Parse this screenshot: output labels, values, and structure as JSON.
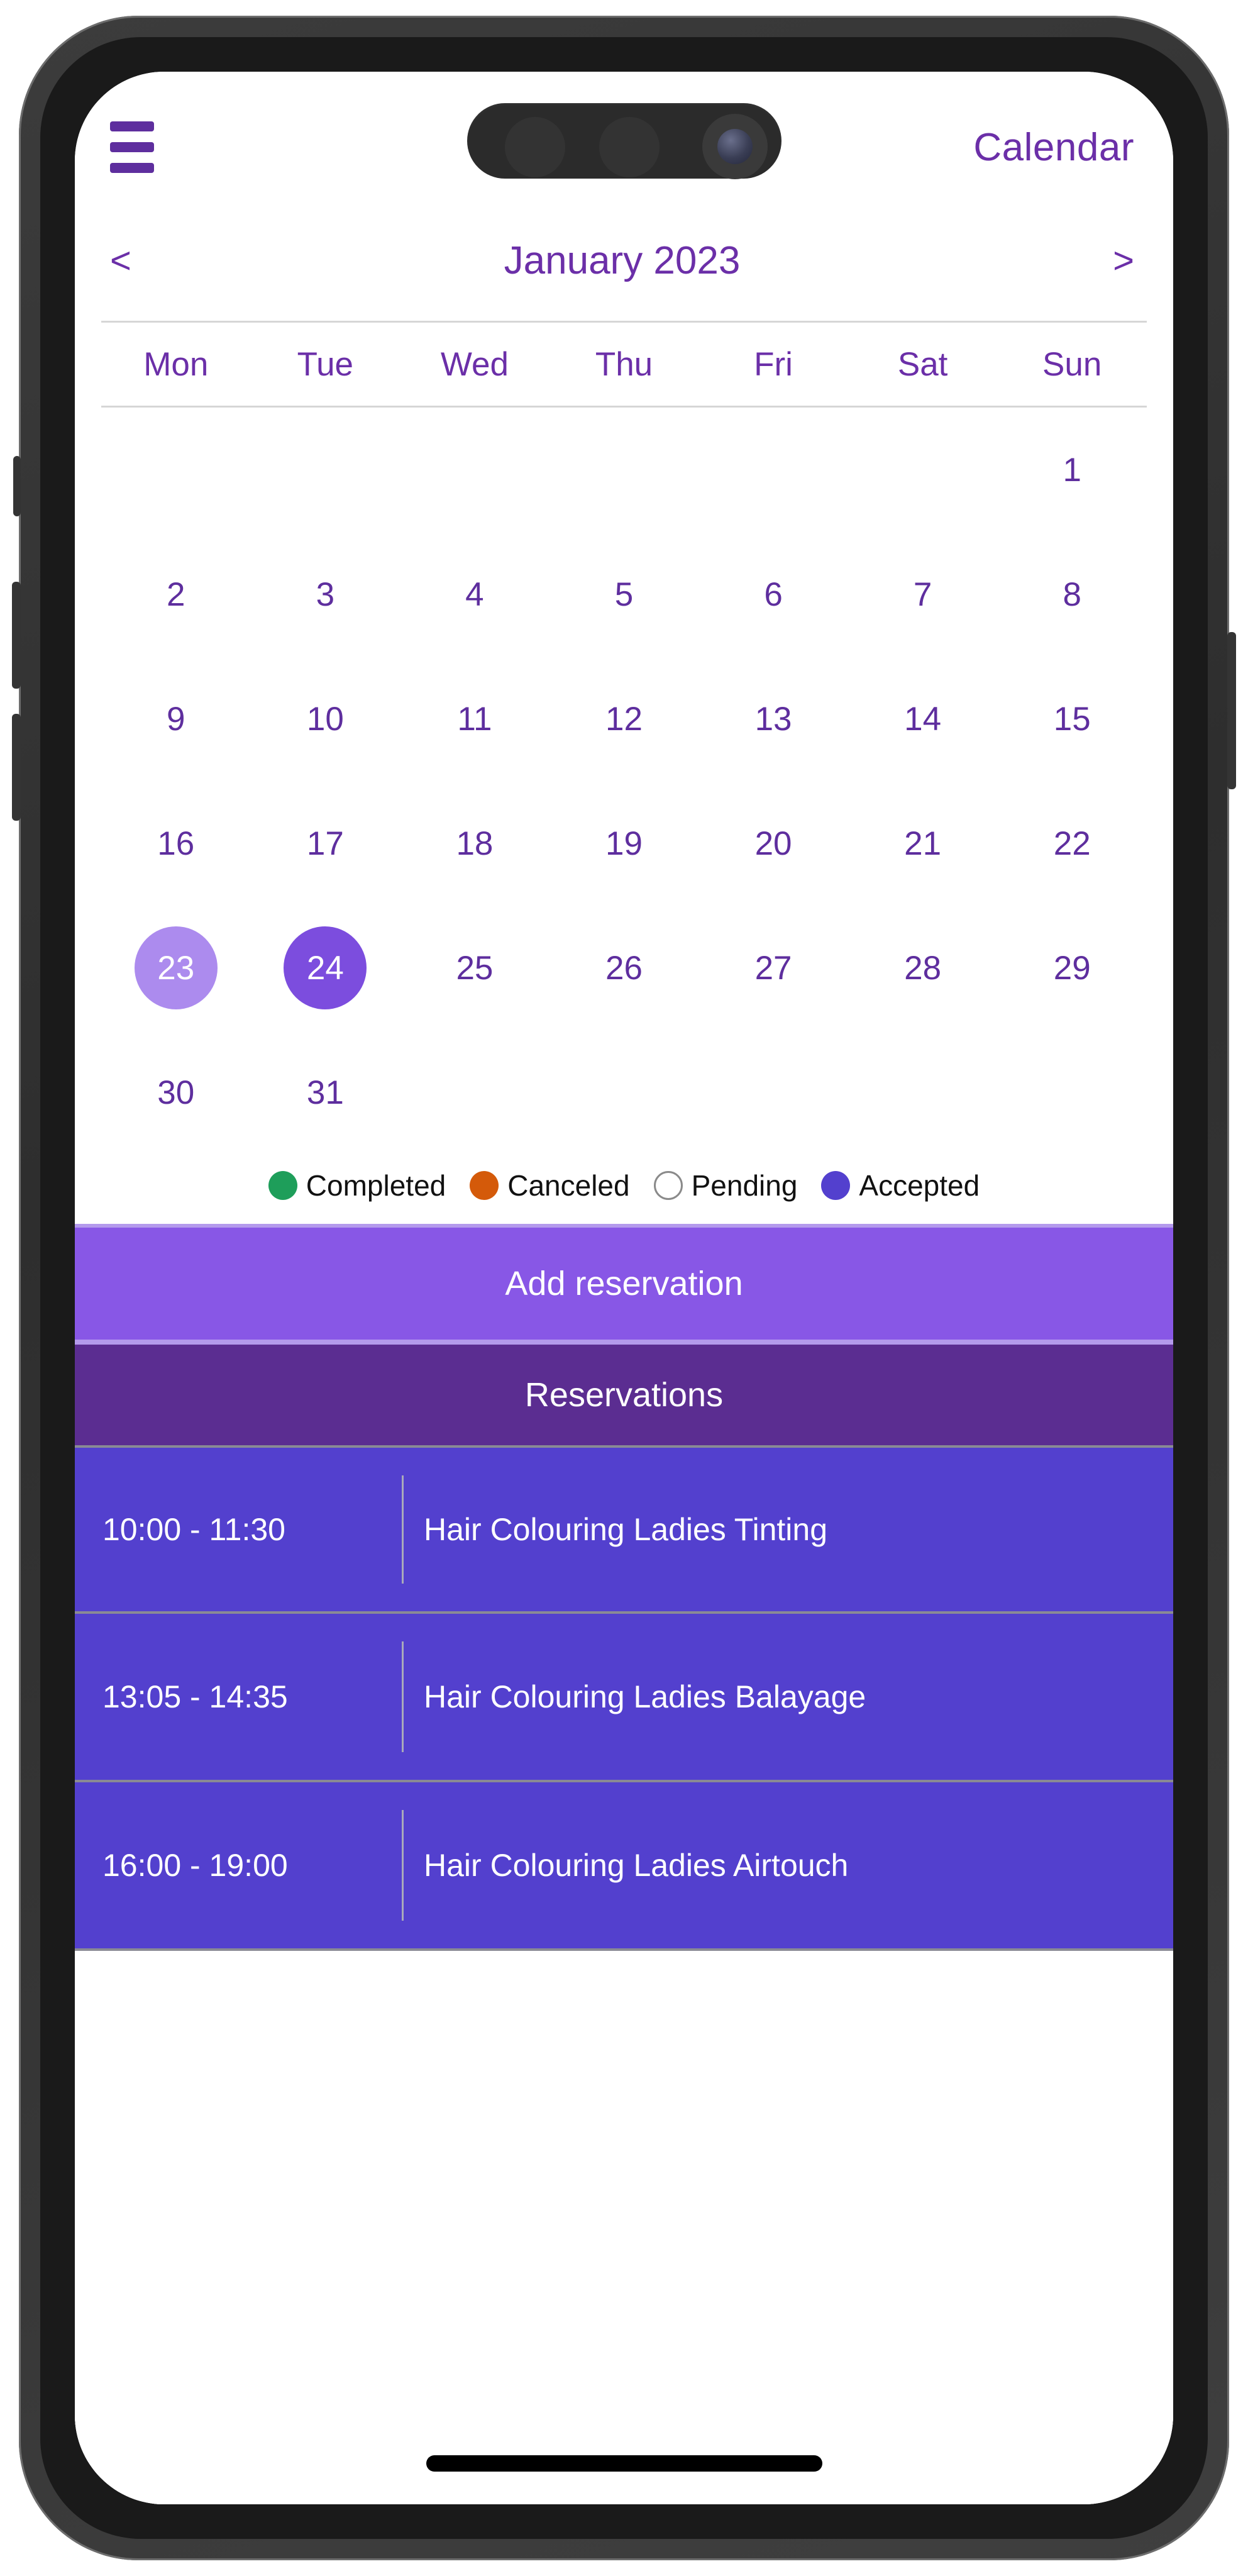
{
  "app": {
    "topbar": {
      "menu_icon": "hamburger-menu-icon",
      "title": "Calendar"
    },
    "month_nav": {
      "prev_label": "<",
      "next_label": ">",
      "month_label": "January 2023"
    },
    "calendar": {
      "weekdays": [
        "Mon",
        "Tue",
        "Wed",
        "Thu",
        "Fri",
        "Sat",
        "Sun"
      ],
      "leading_blanks": 6,
      "days": [
        {
          "num": "1",
          "state": "normal"
        },
        {
          "num": "2",
          "state": "normal"
        },
        {
          "num": "3",
          "state": "normal"
        },
        {
          "num": "4",
          "state": "normal"
        },
        {
          "num": "5",
          "state": "normal"
        },
        {
          "num": "6",
          "state": "normal"
        },
        {
          "num": "7",
          "state": "normal"
        },
        {
          "num": "8",
          "state": "normal"
        },
        {
          "num": "9",
          "state": "normal"
        },
        {
          "num": "10",
          "state": "normal"
        },
        {
          "num": "11",
          "state": "normal"
        },
        {
          "num": "12",
          "state": "normal"
        },
        {
          "num": "13",
          "state": "normal"
        },
        {
          "num": "14",
          "state": "normal"
        },
        {
          "num": "15",
          "state": "normal"
        },
        {
          "num": "16",
          "state": "normal"
        },
        {
          "num": "17",
          "state": "normal"
        },
        {
          "num": "18",
          "state": "normal"
        },
        {
          "num": "19",
          "state": "normal"
        },
        {
          "num": "20",
          "state": "normal"
        },
        {
          "num": "21",
          "state": "normal"
        },
        {
          "num": "22",
          "state": "normal"
        },
        {
          "num": "23",
          "state": "today"
        },
        {
          "num": "24",
          "state": "selected"
        },
        {
          "num": "25",
          "state": "normal"
        },
        {
          "num": "26",
          "state": "normal"
        },
        {
          "num": "27",
          "state": "normal"
        },
        {
          "num": "28",
          "state": "normal"
        },
        {
          "num": "29",
          "state": "normal"
        },
        {
          "num": "30",
          "state": "normal"
        },
        {
          "num": "31",
          "state": "normal"
        }
      ],
      "today_color": "#AC8BEE",
      "selected_color": "#7C4DDE",
      "day_text_color": "#5E2E9E"
    },
    "legend": [
      {
        "label": "Completed",
        "color": "#1E9E5A",
        "hollow": false
      },
      {
        "label": "Canceled",
        "color": "#D45A0A",
        "hollow": false
      },
      {
        "label": "Pending",
        "color": "#ffffff",
        "hollow": true
      },
      {
        "label": "Accepted",
        "color": "#5340CE",
        "hollow": false
      }
    ],
    "add_reservation": {
      "label": "Add reservation",
      "background": "#8857E6"
    },
    "reservations_header": {
      "label": "Reservations",
      "background": "#5B2D91"
    },
    "reservations": [
      {
        "time": "10:00 - 11:30",
        "title": "Hair Colouring Ladies Tinting"
      },
      {
        "time": "13:05 - 14:35",
        "title": "Hair Colouring Ladies Balayage"
      },
      {
        "time": "16:00 - 19:00",
        "title": "Hair Colouring Ladies Airtouch"
      }
    ],
    "row_background": "#5340CE"
  }
}
